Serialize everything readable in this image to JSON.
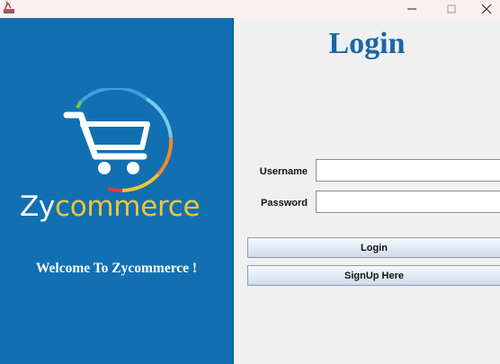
{
  "window": {
    "icons": {
      "app": "java-app-icon",
      "minimize": "minimize-icon",
      "maximize": "maximize-icon",
      "close": "close-icon"
    }
  },
  "brand": {
    "name_part1": "Zy",
    "name_part2": "commerce",
    "welcome": "Welcome To Zycommerce !",
    "logo_icon": "shopping-cart-icon",
    "colors": {
      "panel": "#1270b2",
      "accent": "#f0c43a",
      "arc_blue": "#3aa0e0",
      "arc_orange": "#f08a2a",
      "arc_green": "#7cc04a",
      "arc_red": "#e23c3c"
    }
  },
  "login": {
    "title": "Login",
    "username_label": "Username",
    "username_value": "",
    "password_label": "Password",
    "password_value": "",
    "login_button": "Login",
    "signup_button": "SignUp Here",
    "title_color": "#1a66a8"
  }
}
